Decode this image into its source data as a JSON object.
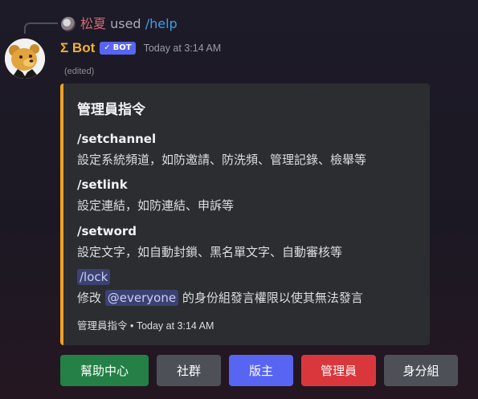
{
  "reply": {
    "user": "松夏",
    "used": "used",
    "command": "/help"
  },
  "message": {
    "author": "Σ Bot",
    "badge": "BOT",
    "timestamp": "Today at 3:14 AM",
    "edited": "(edited)"
  },
  "embed": {
    "accent_color": "#f0a02a",
    "title": "管理員指令",
    "fields": [
      {
        "name": "/setchannel",
        "value": "設定系統頻道，如防邀請、防洗頻、管理記錄、檢舉等"
      },
      {
        "name": "/setlink",
        "value": "設定連結，如防連結、申訴等"
      },
      {
        "name": "/setword",
        "value": "設定文字，如自動封鎖、黑名單文字、自動審核等"
      },
      {
        "name": "/lock",
        "value_prefix": "修改",
        "mention": "@everyone",
        "value_suffix": "的身份組發言權限以使其無法發言"
      }
    ],
    "footer": "管理員指令 • Today at 3:14 AM"
  },
  "buttons": [
    {
      "label": "幫助中心",
      "color": "#248046"
    },
    {
      "label": "社群",
      "color": "#4e5058"
    },
    {
      "label": "版主",
      "color": "#5865f2"
    },
    {
      "label": "管理員",
      "color": "#da373c"
    },
    {
      "label": "身分組",
      "color": "#4e5058"
    }
  ]
}
